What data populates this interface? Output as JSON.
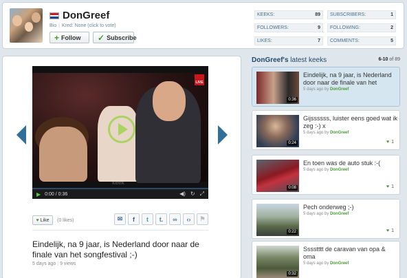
{
  "profile": {
    "username": "DonGreef",
    "bio_link": "Bio",
    "kred_text": "Kred: None (click to vote)",
    "follow_label": "Follow",
    "subscribe_label": "Subscribe",
    "flag": "netherlands-flag"
  },
  "stats": {
    "keeks_label": "KEEKS:",
    "keeks_value": "89",
    "followers_label": "FOLLOWERS:",
    "followers_value": "9",
    "likes_label": "LIKES:",
    "likes_value": "7",
    "subscribers_label": "SUBSCRIBERS:",
    "subscribers_value": "1",
    "following_label": "FOLLOWING:",
    "following_value": "2",
    "comments_label": "COMMENTS:",
    "comments_value": "5"
  },
  "player": {
    "time": "0:00 / 0:36",
    "live_badge": "LIVE",
    "watermark": "keek",
    "like_label": "Like",
    "likes_count": "(0 likes)",
    "title": "Eindelijk, na 9 jaar, is Nederland door naar de finale van het songfestival ;-)",
    "date": "5 days ago",
    "views": "9 views"
  },
  "sidebar": {
    "title_user": "DonGreef's",
    "title_rest": "latest keeks",
    "range": "6-10",
    "of_label": "of",
    "total": "89",
    "items": [
      {
        "title": "Eindelijk, na 9 jaar, is Nederland door naar de finale van het",
        "date": "5 days ago",
        "by": "by",
        "author": "DonGreef",
        "duration": "0:36",
        "likes": ""
      },
      {
        "title": "Gijssssss, luister eens goed wat ik zeg :-) x",
        "date": "5 days ago",
        "by": "by",
        "author": "DonGreef",
        "duration": "0:24",
        "likes": "1"
      },
      {
        "title": "En toen was de auto stuk :-(",
        "date": "5 days ago",
        "by": "by",
        "author": "DonGreef",
        "duration": "0:08",
        "likes": "1"
      },
      {
        "title": "Pech onderweg ;-)",
        "date": "5 days ago",
        "by": "by",
        "author": "DonGreef",
        "duration": "0:22",
        "likes": "1"
      },
      {
        "title": "Sssstttt de caravan van opa & oma",
        "date": "5 days ago",
        "by": "by",
        "author": "DonGreef",
        "duration": "0:32",
        "likes": ""
      }
    ]
  },
  "colors": {
    "accent_blue": "#234a6b",
    "green": "#4a9a34",
    "active_item": "#d6e6f1"
  }
}
